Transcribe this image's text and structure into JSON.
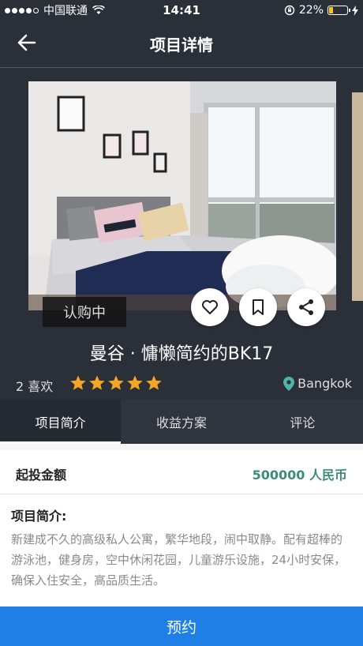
{
  "status_bar": {
    "carrier": "中国联通",
    "time": "14:41",
    "battery": "22%",
    "battery_level": 0.22
  },
  "navbar": {
    "title": "项目详情",
    "back_icon": "arrow-left-icon"
  },
  "hero": {
    "status_tag": "认购中",
    "actions": [
      "heart-icon",
      "bookmark-icon",
      "share-icon"
    ]
  },
  "project": {
    "title": "曼谷 · 慵懒简约的BK17",
    "likes": "2 喜欢",
    "rating": 5,
    "rating_max": 5,
    "location": "Bangkok"
  },
  "tabs": [
    {
      "label": "项目简介",
      "active": true
    },
    {
      "label": "收益方案",
      "active": false
    },
    {
      "label": "评论",
      "active": false
    }
  ],
  "investment": {
    "label": "起投金额",
    "value": "500000 人民币"
  },
  "summary": {
    "heading": "项目简介:",
    "text": "新建成不久的高级私人公寓，繁华地段，闹中取静。配有超棒的游泳池，健身房，空中休闲花园，儿童游乐设施，24小时安保，确保入住安全，高品质生活。"
  },
  "footer": {
    "button_label": "预约"
  },
  "colors": {
    "background": "#2a2f38",
    "accent_blue": "#1e7fe6",
    "value_green": "#3c8c7a",
    "star_orange": "#f5a623",
    "location_pin": "#4fb3a6"
  }
}
